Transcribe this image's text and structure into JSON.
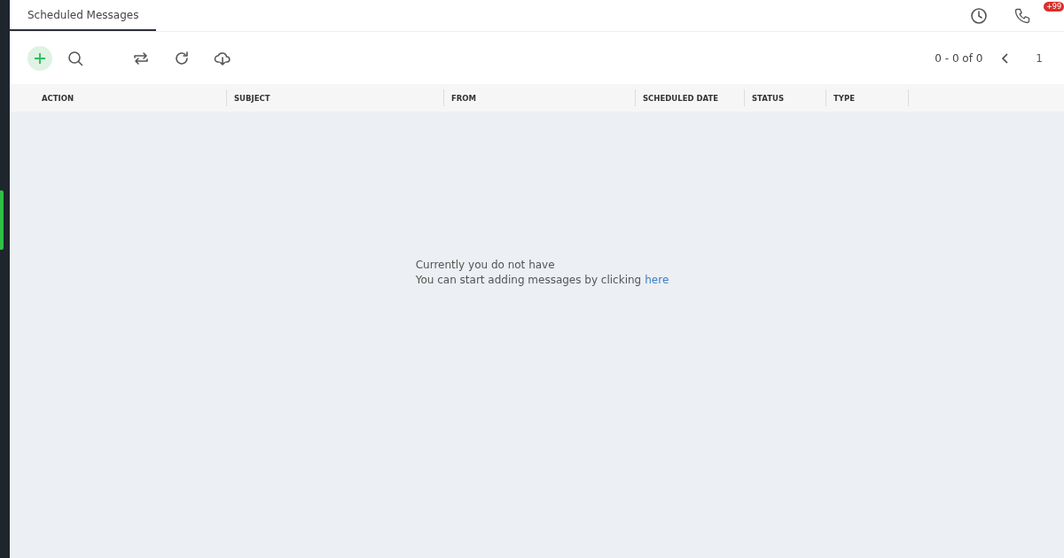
{
  "tabs": [
    {
      "label": "Scheduled Messages",
      "selected": true
    }
  ],
  "notifications": {
    "badge": "+99"
  },
  "pagination": {
    "range": "0 - 0 of 0",
    "page": "1"
  },
  "table": {
    "columns": [
      "ACTION",
      "SUBJECT",
      "FROM",
      "SCHEDULED DATE",
      "STATUS",
      "TYPE"
    ]
  },
  "empty_state": {
    "line_1": "Currently you do not have",
    "line_2": "You can start adding messages by clicking",
    "link": "here"
  }
}
